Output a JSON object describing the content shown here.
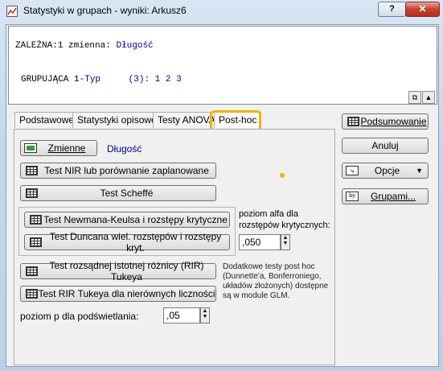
{
  "window": {
    "title": "Statystyki w grupach - wyniki: Arkusz6",
    "help_label": "?",
    "close_label": "✕"
  },
  "variables": {
    "dependent_label": "ZALEŻNA:",
    "dependent_value_prefix": "1 zmienna: ",
    "dependent_value": "Długość",
    "grouping_label": "GRUPUJĄCA",
    "grouping_num": " 1-",
    "grouping_name": "Typ",
    "grouping_count": "(3):",
    "grouping_values": "1 2 3"
  },
  "tabs": [
    "Podstawowe",
    "Statystyki opisowe",
    "Testy ANOVA",
    "Post-hoc"
  ],
  "posthoc": {
    "variables_btn": "Zmienne",
    "variables_value": "Długość",
    "nir_btn": "Test NIR lub porównanie zaplanowane",
    "scheffe_btn": "Test Scheffé",
    "newman_btn": "Test Newmana-Keulsa i rozstępy krytyczne",
    "duncan_btn": "Test Duncana wiel. rozstępów i rozstępy kryt.",
    "alpha_label_1": "poziom alfa dla",
    "alpha_label_2": "rozstępów krytycznych:",
    "alpha_value": ",050",
    "tukey_btn": "Test rozsądnej istotnej różnicy (RIR) Tukeya",
    "tukey_unequal_btn": "Test RIR Tukeya dla nierównych liczności",
    "note": "Dodatkowe testy post hoc (Dunnette'a, Bonferroniego, układów złożonych) dostępne są w module GLM.",
    "p_label": "poziom p dla podświetlania:",
    "p_value": ",05"
  },
  "side": {
    "summary_btn": "Podsumowanie",
    "cancel_btn": "Anuluj",
    "options_btn": "Opcje",
    "groups_btn": "Grupami..."
  },
  "colors": {
    "accent_highlight": "#f0b400",
    "value_text": "#00008b"
  }
}
